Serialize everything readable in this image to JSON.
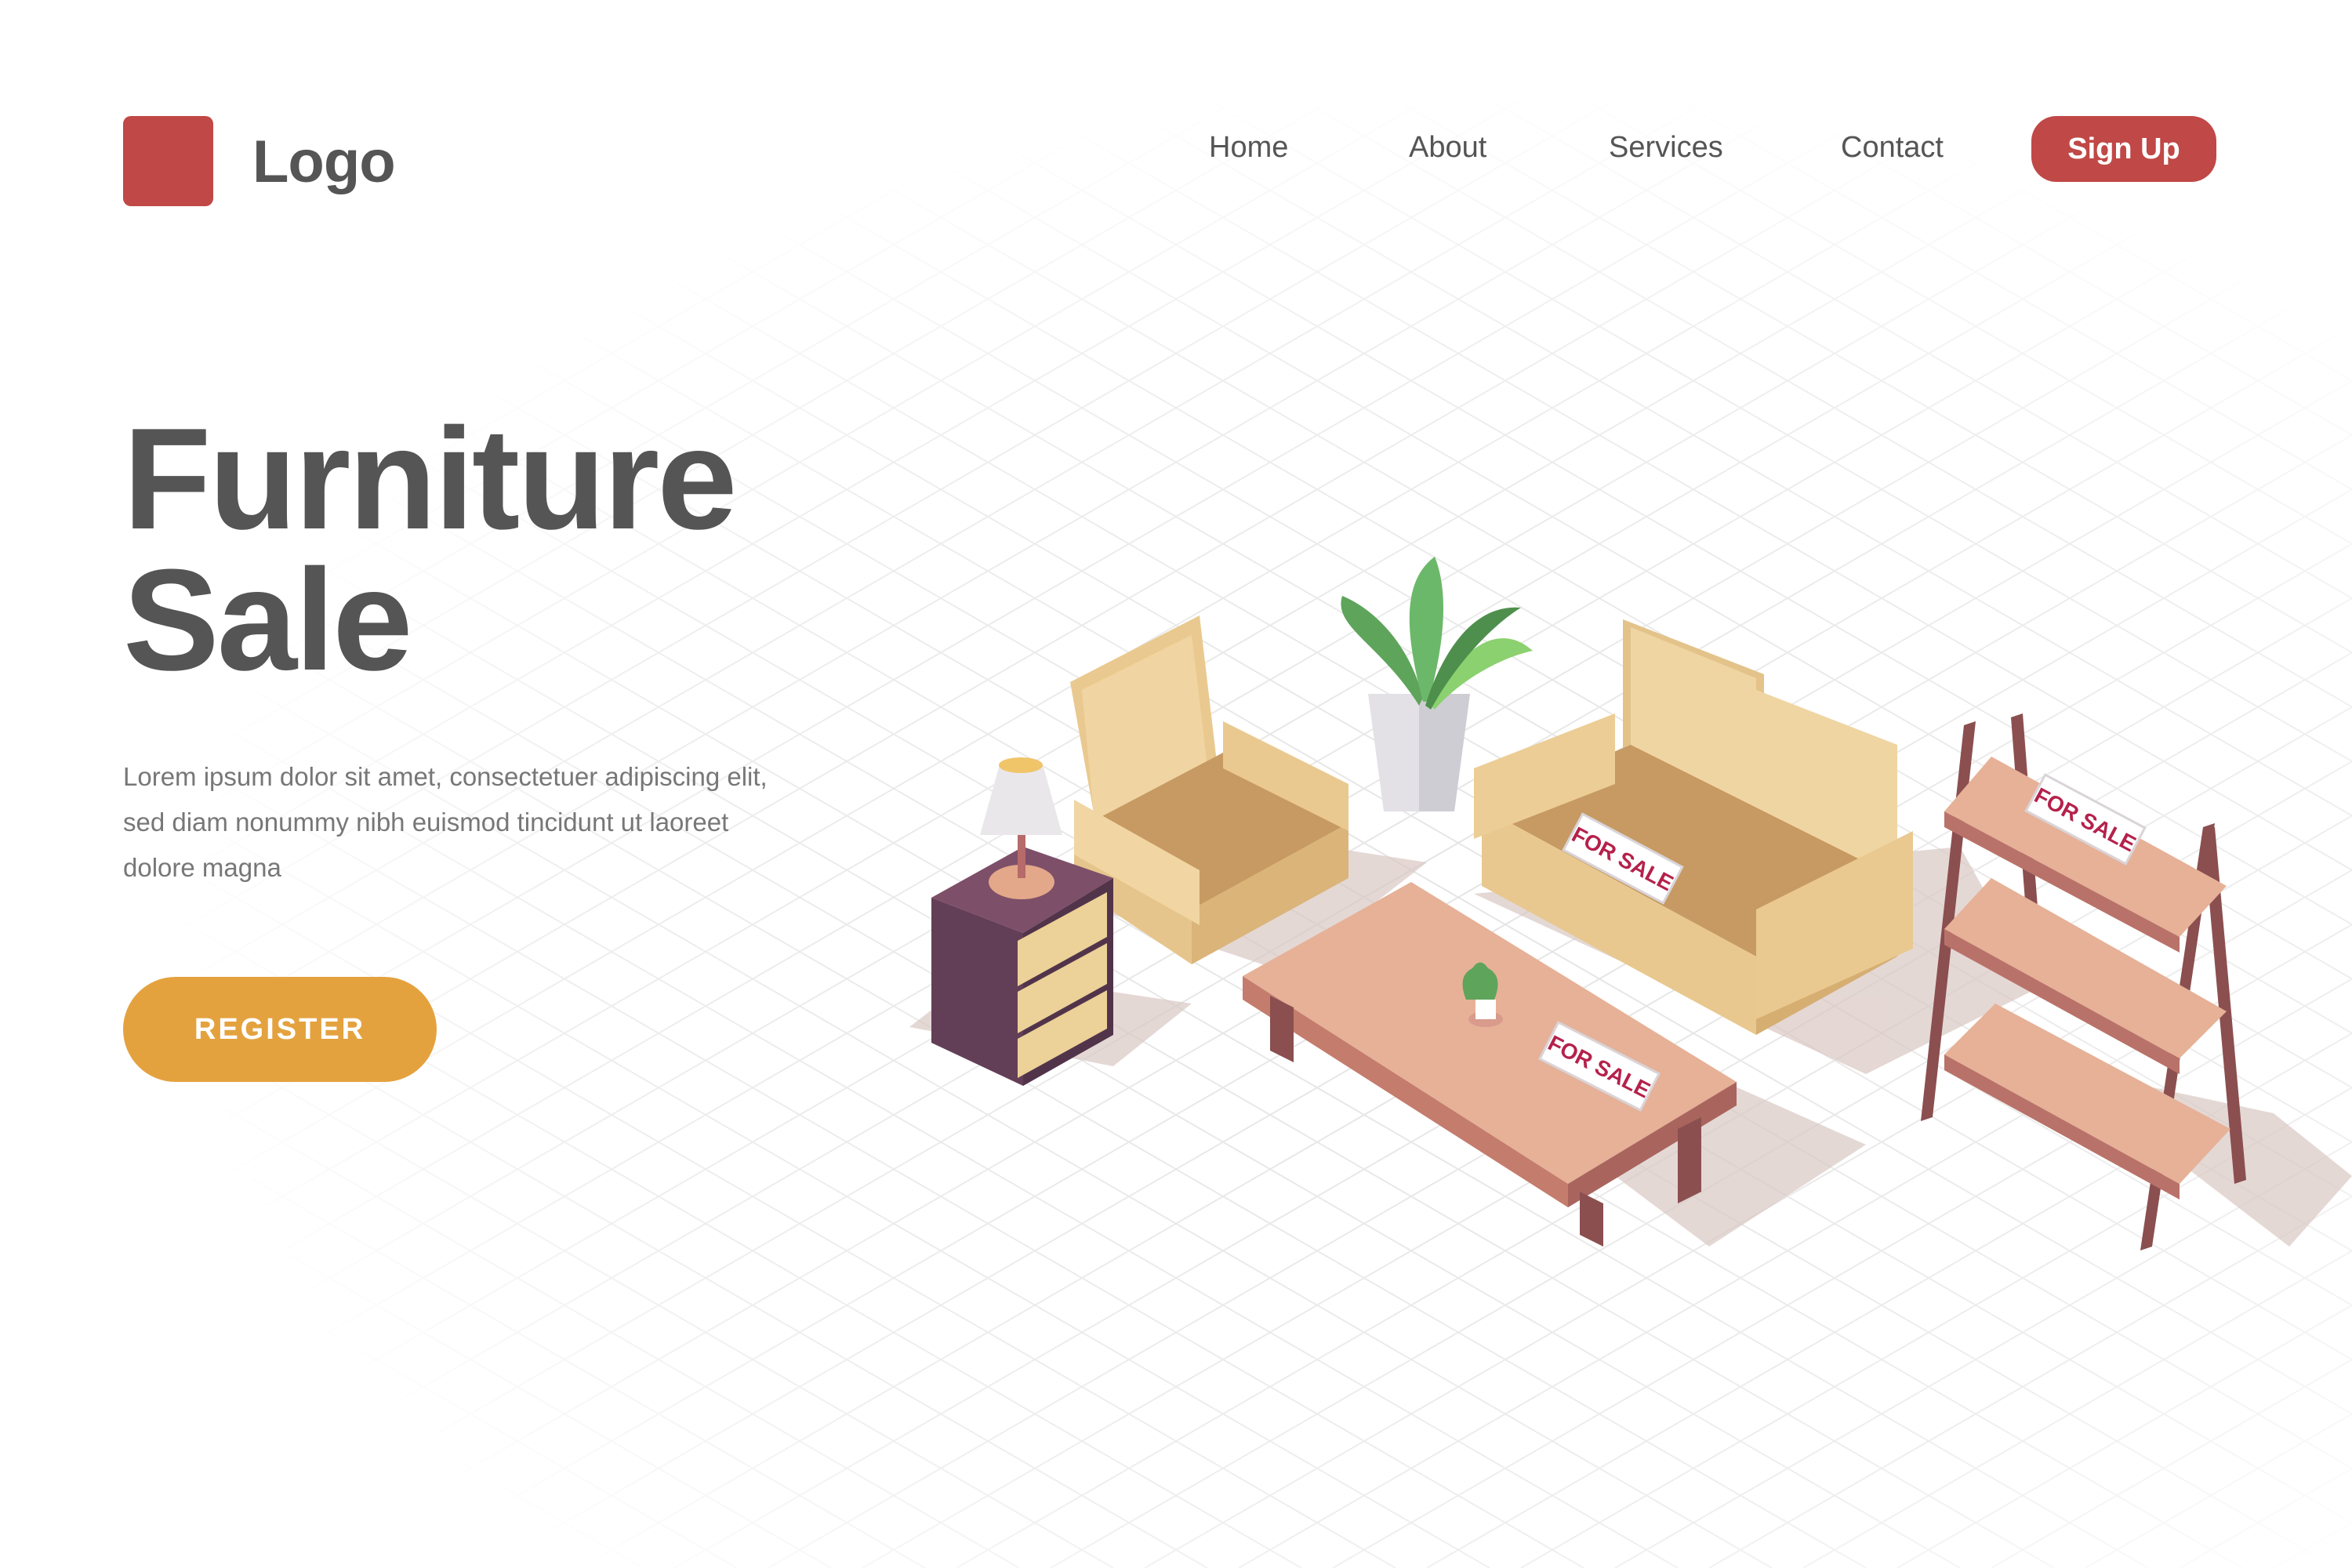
{
  "header": {
    "logo_text": "Logo",
    "nav": [
      "Home",
      "About",
      "Services",
      "Contact"
    ],
    "signup_label": "Sign Up"
  },
  "hero": {
    "title_line1": "Furniture",
    "title_line2": "Sale",
    "description_line1": "Lorem ipsum dolor sit amet, consectetuer adipiscing elit,",
    "description_line2": "sed diam nonummy nibh euismod tincidunt ut laoreet",
    "description_line3": "dolore magna",
    "register_label": "REGISTER"
  },
  "illustration": {
    "sale_tag_text": "FOR SALE"
  },
  "colors": {
    "brand_red": "#c04846",
    "accent_orange": "#e4a23e",
    "text_gray": "#555555"
  }
}
